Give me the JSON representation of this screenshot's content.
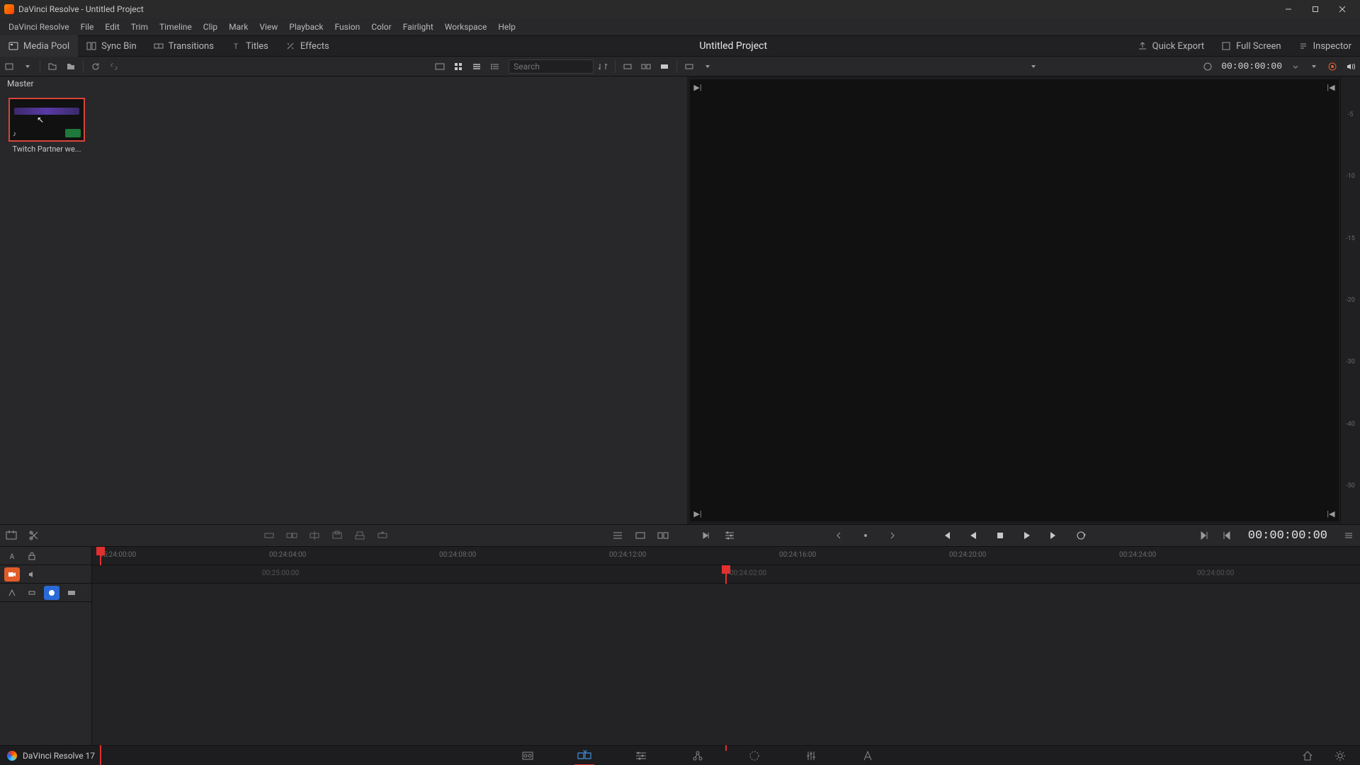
{
  "titlebar": {
    "title": "DaVinci Resolve - Untitled Project"
  },
  "menubar": [
    "DaVinci Resolve",
    "File",
    "Edit",
    "Trim",
    "Timeline",
    "Clip",
    "Mark",
    "View",
    "Playback",
    "Fusion",
    "Color",
    "Fairlight",
    "Workspace",
    "Help"
  ],
  "workspace_tabs": {
    "left": [
      {
        "icon": "media-pool-icon",
        "label": "Media Pool",
        "active": true
      },
      {
        "icon": "sync-bin-icon",
        "label": "Sync Bin"
      },
      {
        "icon": "transitions-icon",
        "label": "Transitions"
      },
      {
        "icon": "titles-icon",
        "label": "Titles"
      },
      {
        "icon": "effects-icon",
        "label": "Effects"
      }
    ],
    "center_title": "Untitled Project",
    "right": [
      {
        "icon": "quick-export-icon",
        "label": "Quick Export"
      },
      {
        "icon": "full-screen-icon",
        "label": "Full Screen"
      },
      {
        "icon": "inspector-icon",
        "label": "Inspector"
      }
    ]
  },
  "toolstrip": {
    "search_placeholder": "Search",
    "viewer_timecode": "00:00:00:00"
  },
  "mediapool": {
    "breadcrumb": "Master",
    "clips": [
      {
        "name": "Twitch Partner we..."
      }
    ]
  },
  "viewer": {
    "meter_labels": [
      "-5",
      "-10",
      "-15",
      "-20",
      "-30",
      "-40",
      "-50"
    ]
  },
  "transport": {
    "timecode": "00:00:00:00"
  },
  "timeline": {
    "ruler_ticks": [
      "05:24:00:00",
      "00:24:04:00",
      "00:24:08:00",
      "00:24:12:00",
      "00:24:16:00",
      "00:24:20:00",
      "00:24:24:00"
    ],
    "subruler_ticks": [
      "00:25:00:00",
      "00:24:02:00",
      "00:24:00:00"
    ],
    "playhead1_pct": 1,
    "playhead2_pct": 50
  },
  "pagebar": {
    "brand": "DaVinci Resolve 17"
  }
}
